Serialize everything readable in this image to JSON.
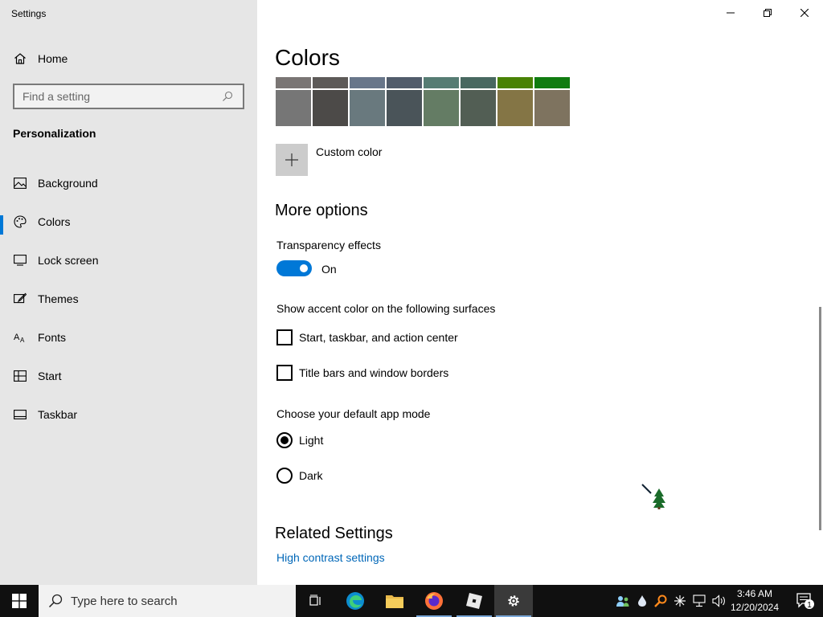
{
  "window": {
    "title": "Settings"
  },
  "sidebar": {
    "home_label": "Home",
    "search_placeholder": "Find a setting",
    "section_heading": "Personalization",
    "items": [
      {
        "label": "Background",
        "icon": "picture-icon"
      },
      {
        "label": "Colors",
        "icon": "palette-icon",
        "selected": true
      },
      {
        "label": "Lock screen",
        "icon": "lock-screen-icon"
      },
      {
        "label": "Themes",
        "icon": "brush-icon"
      },
      {
        "label": "Fonts",
        "icon": "font-icon"
      },
      {
        "label": "Start",
        "icon": "start-layout-icon"
      },
      {
        "label": "Taskbar",
        "icon": "taskbar-icon"
      }
    ]
  },
  "main": {
    "page_title": "Colors",
    "swatch_colors_top": [
      "#7a7574",
      "#5d5a58",
      "#68768a",
      "#515c6b",
      "#567c73",
      "#486860",
      "#498205",
      "#107c10"
    ],
    "swatch_colors_bottom": [
      "#767676",
      "#4c4a48",
      "#69797e",
      "#4a5459",
      "#647c64",
      "#525e54",
      "#847545",
      "#7e735f"
    ],
    "custom_color_label": "Custom color",
    "more_options_heading": "More options",
    "transparency_label": "Transparency effects",
    "transparency_state": "On",
    "accent_surfaces_label": "Show accent color on the following surfaces",
    "checkbox_start": "Start, taskbar, and action center",
    "checkbox_titlebars": "Title bars and window borders",
    "app_mode_label": "Choose your default app mode",
    "radio_light": "Light",
    "radio_dark": "Dark",
    "related_heading": "Related Settings",
    "high_contrast_link": "High contrast settings"
  },
  "taskbar": {
    "search_text": "Type here to search",
    "clock_time": "3:46 AM",
    "clock_date": "12/20/2024",
    "notification_count": "1"
  },
  "colors": {
    "accent": "#0078d7",
    "link": "#0067b8",
    "sidebar_bg": "#e6e6e6",
    "taskbar_bg": "#101010"
  }
}
